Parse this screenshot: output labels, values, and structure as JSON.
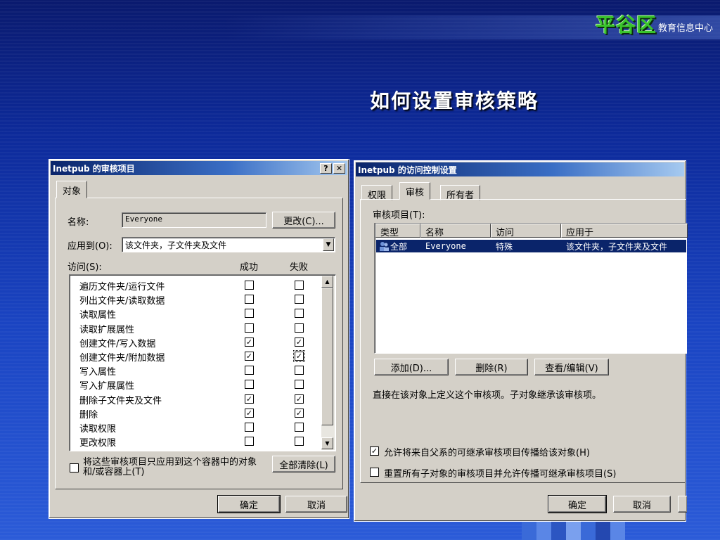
{
  "slide": {
    "title": "如何设置审核策略",
    "logo_main": "平谷区",
    "logo_sub": "教育信息中心"
  },
  "colors": {
    "background": "#1a44c2",
    "titlebar": "#0a246a",
    "dialog_face": "#d4d0c8",
    "selection": "#0a246a",
    "logo_green": "#39c42b"
  },
  "audit_entry_dialog": {
    "title": "Inetpub 的审核项目",
    "help_button": "?",
    "close_button": "✕",
    "tab": "对象",
    "name_label": "名称:",
    "name_value": "Everyone",
    "change_button": "更改(C)...",
    "apply_to_label": "应用到(O):",
    "apply_to_value": "该文件夹，子文件夹及文件",
    "access_label": "访问(S):",
    "col_success": "成功",
    "col_failure": "失败",
    "permissions": [
      {
        "name": "遍历文件夹/运行文件",
        "success": false,
        "failure": false
      },
      {
        "name": "列出文件夹/读取数据",
        "success": false,
        "failure": false
      },
      {
        "name": "读取属性",
        "success": false,
        "failure": false
      },
      {
        "name": "读取扩展属性",
        "success": false,
        "failure": false
      },
      {
        "name": "创建文件/写入数据",
        "success": true,
        "failure": true
      },
      {
        "name": "创建文件夹/附加数据",
        "success": true,
        "failure": true
      },
      {
        "name": "写入属性",
        "success": false,
        "failure": false
      },
      {
        "name": "写入扩展属性",
        "success": false,
        "failure": false
      },
      {
        "name": "删除子文件夹及文件",
        "success": true,
        "failure": true
      },
      {
        "name": "删除",
        "success": true,
        "failure": true
      },
      {
        "name": "读取权限",
        "success": false,
        "failure": false
      },
      {
        "name": "更改权限",
        "success": false,
        "failure": false
      }
    ],
    "apply_only_checkbox": "将这些审核项目只应用到这个容器中的对象和/或容器上(T)",
    "apply_only_checked": false,
    "clear_all_button": "全部清除(L)",
    "ok_button": "确定",
    "cancel_button": "取消"
  },
  "access_control_dialog": {
    "title": "Inetpub 的访问控制设置",
    "tabs": [
      "权限",
      "审核",
      "所有者"
    ],
    "active_tab": "审核",
    "entries_label": "审核项目(T):",
    "columns": [
      "类型",
      "名称",
      "访问",
      "应用于"
    ],
    "rows": [
      {
        "type": "全部",
        "name": "Everyone",
        "access": "特殊",
        "apply_to": "该文件夹，子文件夹及文件"
      }
    ],
    "add_button": "添加(D)...",
    "remove_button": "删除(R)",
    "view_edit_button": "查看/编辑(V)",
    "description": "直接在该对象上定义这个审核项。子对象继承该审核项。",
    "inherit_checkbox": "允许将来自父系的可继承审核项目传播给该对象(H)",
    "inherit_checked": true,
    "reset_checkbox": "重置所有子对象的审核项目并允许传播可继承审核项目(S)",
    "reset_checked": false,
    "ok_button": "确定",
    "cancel_button": "取消"
  }
}
